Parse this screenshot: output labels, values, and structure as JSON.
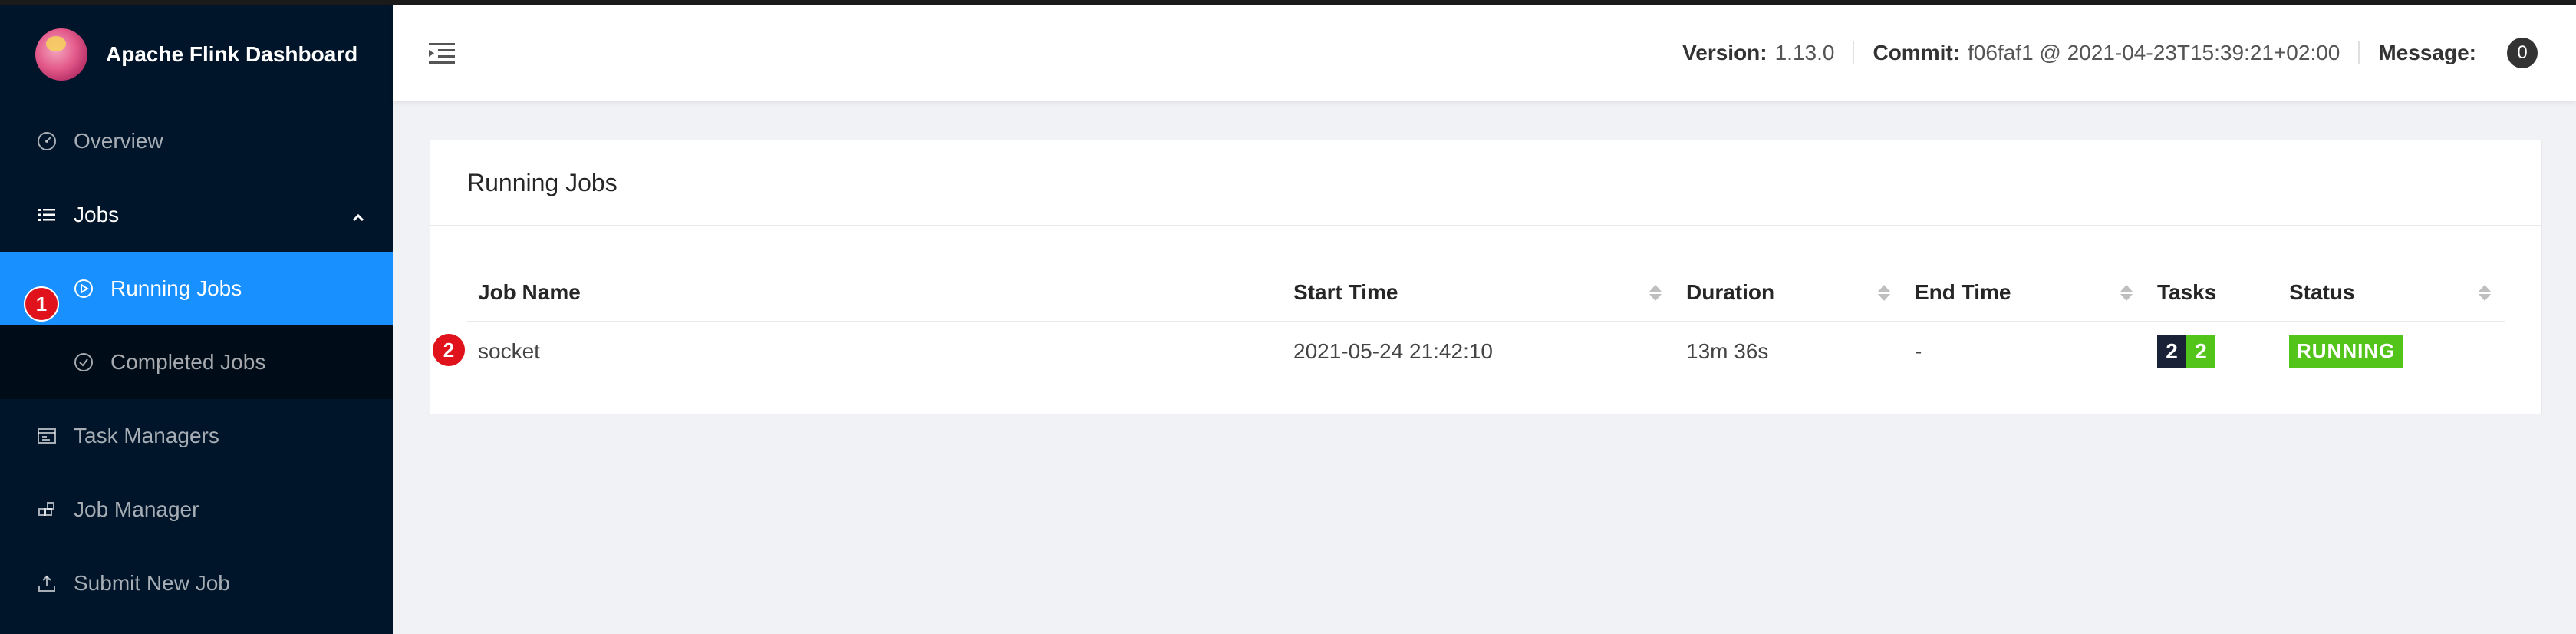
{
  "app": {
    "title": "Apache Flink Dashboard"
  },
  "sidebar": {
    "items": [
      {
        "label": "Overview",
        "icon": "dashboard-icon"
      },
      {
        "label": "Jobs",
        "icon": "list-icon",
        "expanded": true,
        "children": [
          {
            "label": "Running Jobs",
            "icon": "play-circle-icon",
            "active": true
          },
          {
            "label": "Completed Jobs",
            "icon": "check-circle-icon"
          }
        ]
      },
      {
        "label": "Task Managers",
        "icon": "schedule-icon"
      },
      {
        "label": "Job Manager",
        "icon": "build-icon"
      },
      {
        "label": "Submit New Job",
        "icon": "upload-icon"
      }
    ]
  },
  "header": {
    "version_label": "Version:",
    "version_value": "1.13.0",
    "commit_label": "Commit:",
    "commit_value": "f06faf1 @ 2021-04-23T15:39:21+02:00",
    "message_label": "Message:",
    "message_count": "0"
  },
  "main": {
    "card_title": "Running Jobs",
    "columns": [
      "Job Name",
      "Start Time",
      "Duration",
      "End Time",
      "Tasks",
      "Status"
    ],
    "rows": [
      {
        "job_name": "socket",
        "start_time": "2021-05-24 21:42:10",
        "duration": "13m 36s",
        "end_time": "-",
        "tasks_total": "2",
        "tasks_running": "2",
        "status": "RUNNING"
      }
    ]
  },
  "markers": [
    "1",
    "2"
  ],
  "colors": {
    "sidebar_bg": "#001529",
    "active_bg": "#1890ff",
    "running_green": "#52c41a",
    "task_dark": "#1a2238",
    "marker_red": "#e0121b"
  }
}
